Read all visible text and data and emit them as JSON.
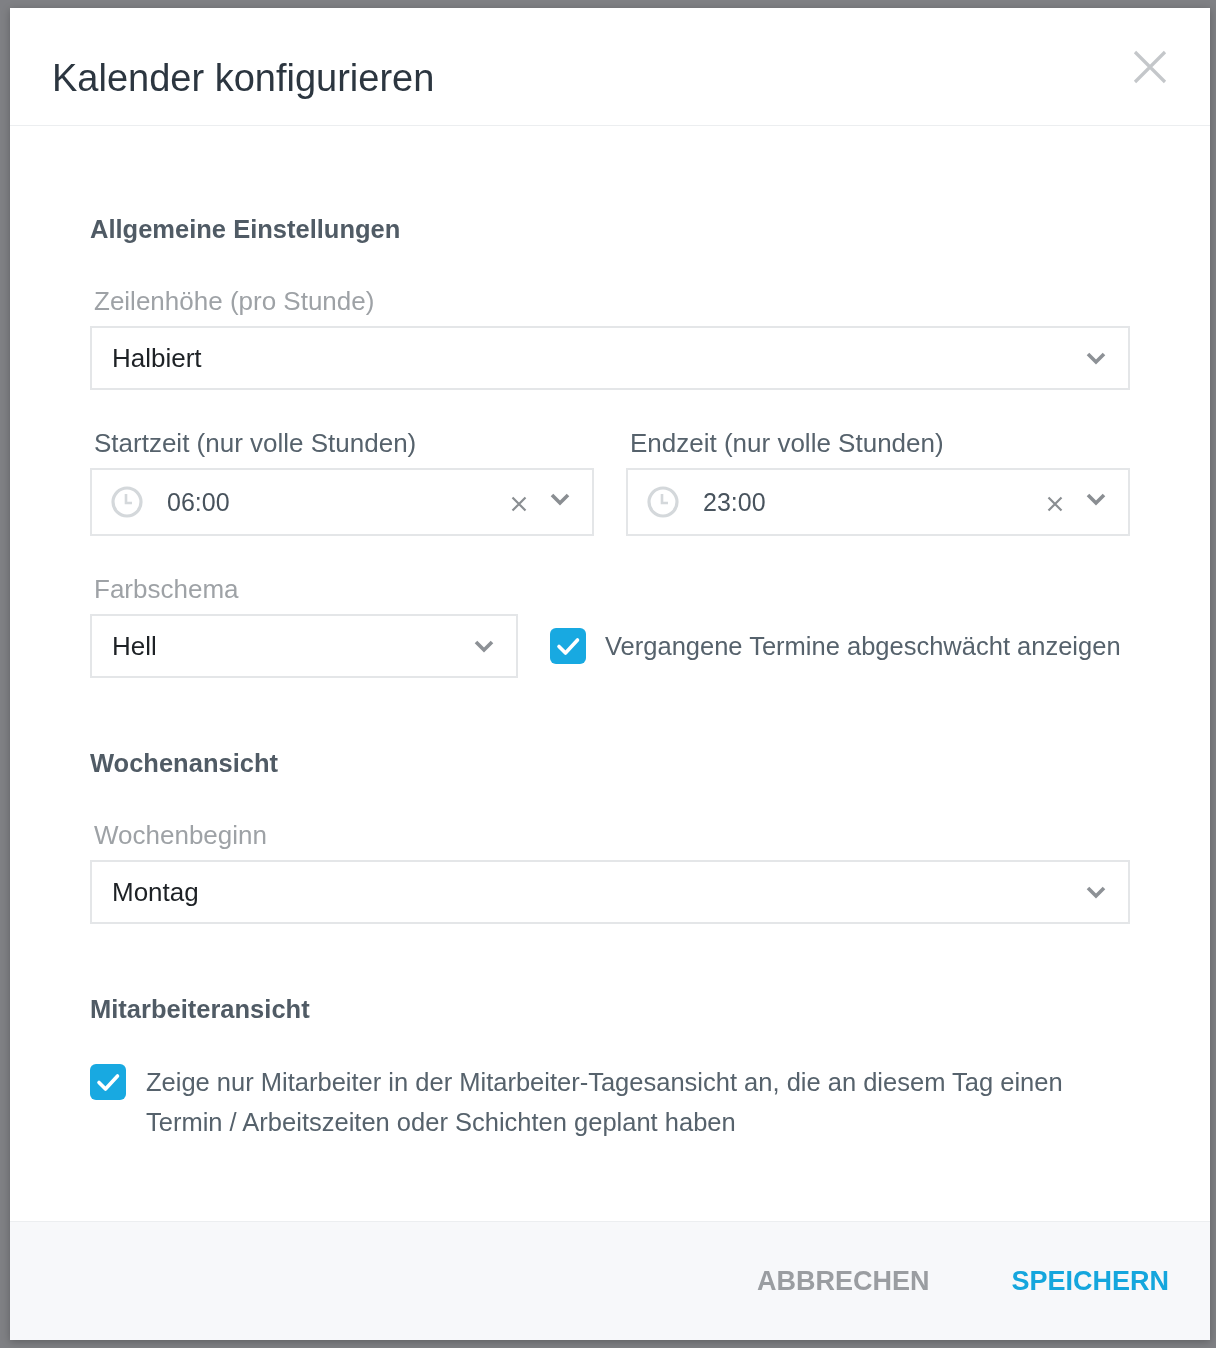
{
  "dialog": {
    "title": "Kalender konfigurieren"
  },
  "sections": [
    {
      "title": "Allgemeine Einstellungen",
      "rows": [
        {
          "fields": [
            {
              "kind": "select",
              "label": "Zeilenhöhe (pro Stunde)",
              "value": "Halbiert"
            }
          ]
        },
        {
          "fields": [
            {
              "kind": "time",
              "label": "Startzeit (nur volle Stunden)",
              "value": "06:00"
            },
            {
              "kind": "time",
              "label": "Endzeit (nur volle Stunden)",
              "value": "23:00"
            }
          ]
        },
        {
          "fields": [
            {
              "kind": "select",
              "label": "Farbschema",
              "value": "Hell"
            },
            {
              "kind": "checkbox",
              "label": "Vergangene Termine abgeschwächt anzeigen",
              "checked": true
            }
          ]
        }
      ]
    },
    {
      "title": "Wochenansicht",
      "rows": [
        {
          "fields": [
            {
              "kind": "select",
              "label": "Wochenbeginn",
              "value": "Montag"
            }
          ]
        }
      ]
    },
    {
      "title": "Mitarbeiteransicht",
      "rows": [
        {
          "fields": [
            {
              "kind": "checkbox",
              "label": "Zeige nur Mitarbeiter in der Mitarbeiter-Tagesansicht an, die an diesem Tag einen Termin / Arbeitszeiten oder Schichten geplant haben",
              "checked": true
            }
          ]
        }
      ]
    }
  ],
  "buttons": [
    {
      "kind": "secondary",
      "label": "ABBRECHEN"
    },
    {
      "kind": "primary",
      "label": "SPEICHERN"
    }
  ]
}
